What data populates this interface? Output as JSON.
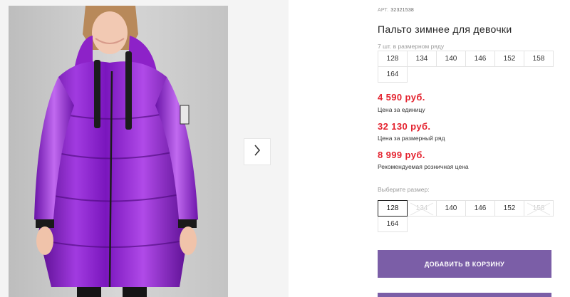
{
  "product": {
    "sku_label": "АРТ.",
    "sku": "32321538",
    "title": "Пальто зимнее для девочки"
  },
  "pack": {
    "note": "7 шт. в размерном ряду",
    "sizes": [
      "128",
      "134",
      "140",
      "146",
      "152",
      "158",
      "164"
    ]
  },
  "prices": {
    "unit_price": "4 590 руб.",
    "unit_label": "Цена за единицу",
    "pack_price": "32 130 руб.",
    "pack_label": "Цена за размерный ряд",
    "retail_price": "8 999 руб.",
    "retail_label": "Рекомендуемая розничная цена"
  },
  "size_select": {
    "label": "Выберите размер:",
    "options": [
      {
        "size": "128",
        "state": "selected"
      },
      {
        "size": "134",
        "state": "unavailable"
      },
      {
        "size": "140",
        "state": "available"
      },
      {
        "size": "146",
        "state": "available"
      },
      {
        "size": "152",
        "state": "available"
      },
      {
        "size": "158",
        "state": "unavailable"
      },
      {
        "size": "164",
        "state": "available"
      }
    ]
  },
  "actions": {
    "add_to_cart": "ДОБАВИТЬ В КОРЗИНУ"
  },
  "gallery": {
    "next_icon": "chevron-right-icon"
  },
  "colors": {
    "price": "#e4222e",
    "accent_button": "#7b5ea7",
    "coat": "#8a1fc4"
  }
}
